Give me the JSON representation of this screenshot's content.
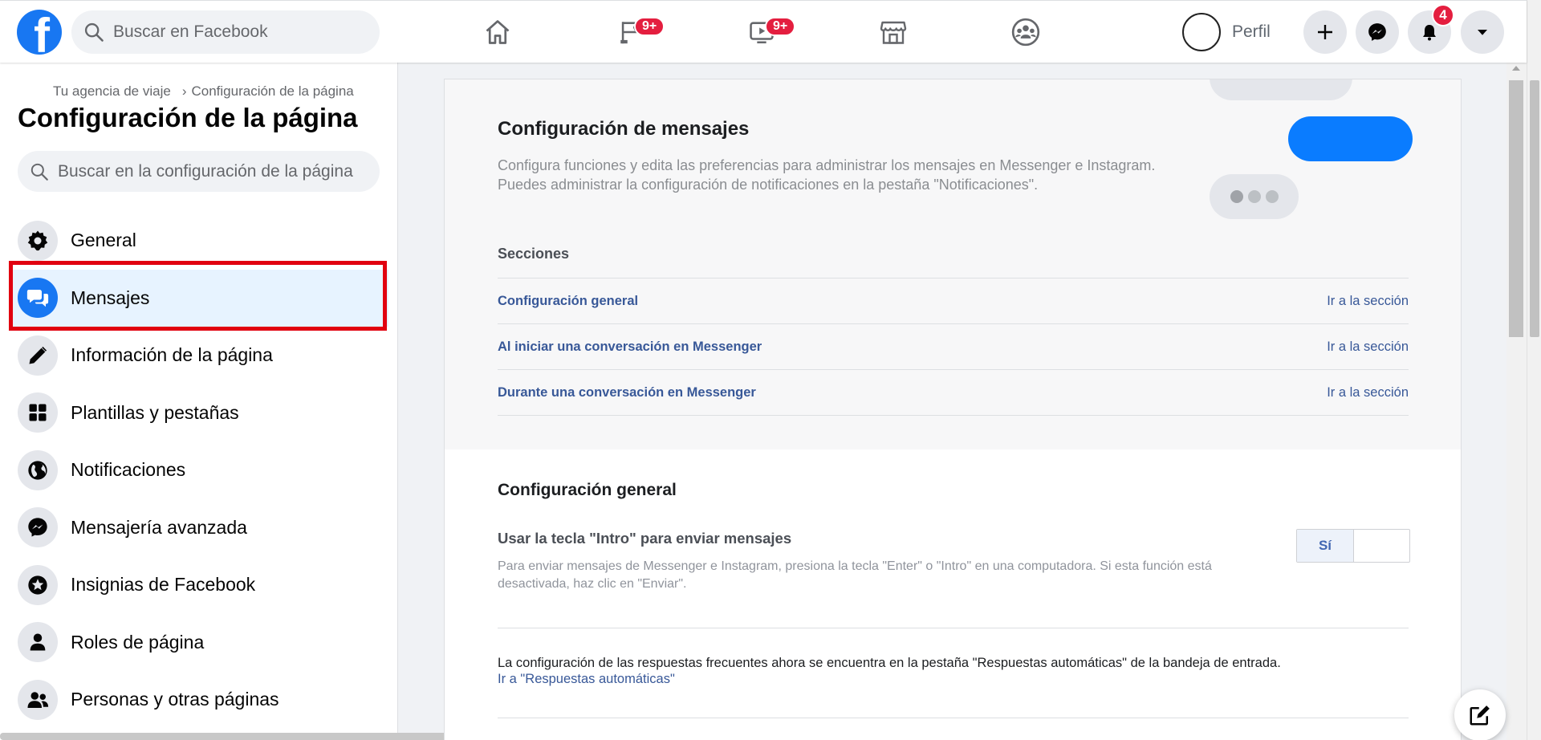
{
  "topbar": {
    "search_placeholder": "Buscar en Facebook",
    "nav": [
      {
        "name": "home-icon",
        "badge": ""
      },
      {
        "name": "pages-flag-icon",
        "badge": "9+"
      },
      {
        "name": "watch-video-icon",
        "badge": "9+"
      },
      {
        "name": "marketplace-store-icon",
        "badge": ""
      },
      {
        "name": "groups-icon",
        "badge": ""
      }
    ],
    "profile_label": "Perfil",
    "notifications_badge": "4"
  },
  "sidebar": {
    "breadcrumb_parent": "Tu agencia de viaje",
    "breadcrumb_sep": "›",
    "breadcrumb_current": "Configuración de la página",
    "title": "Configuración de la página",
    "search_placeholder": "Buscar en la configuración de la página",
    "items": [
      {
        "label": "General",
        "icon": "gear-icon"
      },
      {
        "label": "Mensajes",
        "icon": "chat-bubbles-icon"
      },
      {
        "label": "Información de la página",
        "icon": "pencil-icon"
      },
      {
        "label": "Plantillas y pestañas",
        "icon": "grid-icon"
      },
      {
        "label": "Notificaciones",
        "icon": "globe-icon"
      },
      {
        "label": "Mensajería avanzada",
        "icon": "messenger-icon"
      },
      {
        "label": "Insignias de Facebook",
        "icon": "star-badge-icon"
      },
      {
        "label": "Roles de página",
        "icon": "person-icon"
      },
      {
        "label": "Personas y otras páginas",
        "icon": "people-icon"
      }
    ],
    "active_index": 1
  },
  "main": {
    "title": "Configuración de mensajes",
    "desc_line1": "Configura funciones y edita las preferencias para administrar los mensajes en Messenger e Instagram.",
    "desc_line2": "Puedes administrar la configuración de notificaciones en la pestaña \"Notificaciones\".",
    "sections_heading": "Secciones",
    "sections": [
      {
        "label": "Configuración general",
        "action": "Ir a la sección"
      },
      {
        "label": "Al iniciar una conversación en Messenger",
        "action": "Ir a la sección"
      },
      {
        "label": "Durante una conversación en Messenger",
        "action": "Ir a la sección"
      }
    ],
    "general_title": "Configuración general",
    "enter_option_title": "Usar la tecla \"Intro\" para enviar mensajes",
    "enter_option_desc": "Para enviar mensajes de Messenger e Instagram, presiona la tecla \"Enter\" o \"Intro\" en una computadora. Si esta función está desactivada, haz clic en \"Enviar\".",
    "toggle_on_label": "Sí",
    "note_text": "La configuración de las respuestas frecuentes ahora se encuentra en la pestaña \"Respuestas automáticas\" de la bandeja de entrada.",
    "note_link": "Ir a \"Respuestas automáticas\""
  },
  "colors": {
    "brand": "#1877f2",
    "highlight": "#e1000f",
    "link": "#385898"
  }
}
